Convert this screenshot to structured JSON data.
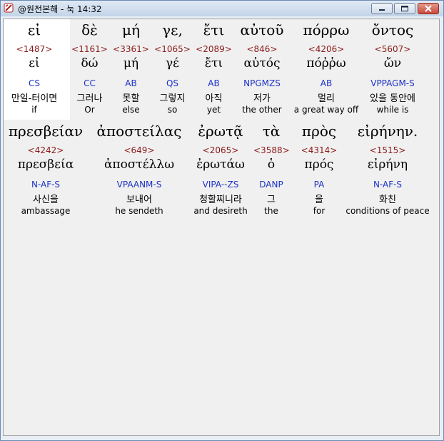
{
  "window": {
    "title": "@원전본해 - 눅 14:32"
  },
  "rows": [
    {
      "words": [
        {
          "greek": "εἰ",
          "strong": "<1487>",
          "lemma": "εἰ",
          "parse": "CS",
          "korean": "만일-터이면",
          "english": "if"
        },
        {
          "greek": "δὲ",
          "strong": "<1161>",
          "lemma": "δώ",
          "parse": "CC",
          "korean": "그러나",
          "english": "Or"
        },
        {
          "greek": "μή",
          "strong": "<3361>",
          "lemma": "μή",
          "parse": "AB",
          "korean": "못할",
          "english": "else"
        },
        {
          "greek": "γε,",
          "strong": "<1065>",
          "lemma": "γέ",
          "parse": "QS",
          "korean": "그렇지",
          "english": "so"
        },
        {
          "greek": "ἔτι",
          "strong": "<2089>",
          "lemma": "ἔτι",
          "parse": "AB",
          "korean": "아직",
          "english": "yet"
        },
        {
          "greek": "αὐτοῦ",
          "strong": "<846>",
          "lemma": "αὐτός",
          "parse": "NPGMZS",
          "korean": "저가",
          "english": "the other"
        },
        {
          "greek": "πόρρω",
          "strong": "<4206>",
          "lemma": "πόῤῥω",
          "parse": "AB",
          "korean": "멀리",
          "english": "a great way off"
        },
        {
          "greek": "ὄντος",
          "strong": "<5607>",
          "lemma": "ὤν",
          "parse": "VPPAGM-S",
          "korean": "있을 동안에",
          "english": "while is"
        }
      ]
    },
    {
      "words": [
        {
          "greek": "πρεσβείαν",
          "strong": "<4242>",
          "lemma": "πρεσβεία",
          "parse": "N-AF-S",
          "korean": "사신을",
          "english": "ambassage"
        },
        {
          "greek": "ἀποστείλας",
          "strong": "<649>",
          "lemma": "ἀποστέλλω",
          "parse": "VPAANM-S",
          "korean": "보내어",
          "english": "he sendeth"
        },
        {
          "greek": "ἐρωτᾷ",
          "strong": "<2065>",
          "lemma": "ἐρωτάω",
          "parse": "VIPA--ZS",
          "korean": "청할찌니라",
          "english": "and desireth"
        },
        {
          "greek": "τὰ",
          "strong": "<3588>",
          "lemma": "ὁ",
          "parse": "DANP",
          "korean": "그",
          "english": "the"
        },
        {
          "greek": "πρὸς",
          "strong": "<4314>",
          "lemma": "πρός",
          "parse": "PA",
          "korean": "을",
          "english": "for"
        },
        {
          "greek": "εἰρήνην.",
          "strong": "<1515>",
          "lemma": "εἰρήνη",
          "parse": "N-AF-S",
          "korean": "화친",
          "english": "conditions of peace"
        }
      ]
    }
  ],
  "colors": {
    "strong_number": "#8b1a1a",
    "parsing_code": "#1c32c6",
    "selected_word_background": "#ffffff"
  }
}
